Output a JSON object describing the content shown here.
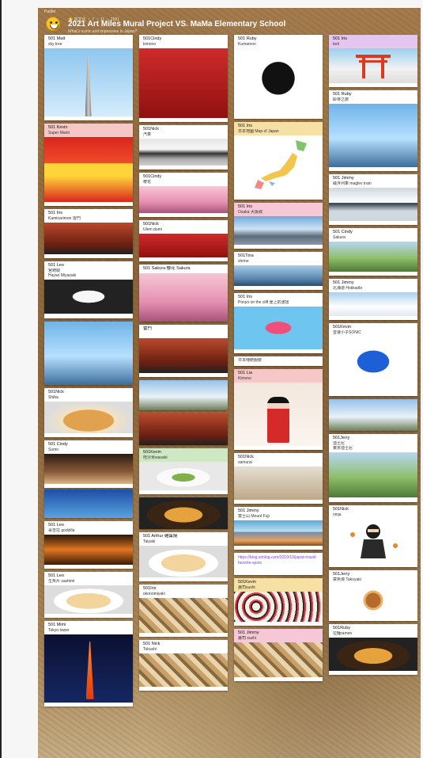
{
  "header": {
    "small_text": "Padlet",
    "meta": "⭐ 宗文化 ・ 7 ・ 11 ・ 2021",
    "title": "2021 Art Miles Mural Project VS. MaMa Elementary School",
    "subtitle": "What's iconic and impressive in Japan?"
  },
  "columns": [
    {
      "cards": [
        {
          "id": "c1",
          "author": "501 Matt",
          "caption": "sky tree",
          "image": "skytree-photo"
        },
        {
          "id": "c2",
          "author": "501 Kevin",
          "caption": "Super Mario",
          "image": "mario-photo"
        },
        {
          "id": "c3",
          "author": "501 Iris",
          "caption": "Kaminarimon 雷門",
          "image": "kaminarimon-photo"
        },
        {
          "id": "c4",
          "author": "501 Leo",
          "caption": "宮崎駿",
          "caption2": "Hayao Miyazaki",
          "image": "miyazaki-photo"
        },
        {
          "id": "c5",
          "author": "",
          "caption": "",
          "image": "anime-photo"
        },
        {
          "id": "c6",
          "author": "501Nick",
          "caption": "Shiba",
          "image": "shiba-photo"
        },
        {
          "id": "c7",
          "author": "501 Cindy",
          "caption": "Sumo",
          "image": "sumo-photo"
        },
        {
          "id": "c8",
          "author": "",
          "caption": "",
          "image": "demon-slayer-photo"
        },
        {
          "id": "c9",
          "author": "501 Leo",
          "caption": "哥吉拉 godzilla",
          "image": "godzilla-photo"
        },
        {
          "id": "c10",
          "author": "501 Leo",
          "caption": "生魚片 sashimi",
          "image": "sashimi-photo"
        },
        {
          "id": "c11",
          "author": "501 Mimi",
          "caption": "Tokyo tower",
          "image": "tokyotower-photo"
        }
      ]
    },
    {
      "cards": [
        {
          "id": "d1",
          "author": "501Cindy",
          "caption": "kimono",
          "image": "kimono-photo"
        },
        {
          "id": "d2",
          "author": "501Nick",
          "caption": "汽車",
          "image": "car-photo"
        },
        {
          "id": "d3",
          "author": "501Cindy",
          "caption": "櫻花",
          "image": "sakura-photo"
        },
        {
          "id": "d4",
          "author": "501Nick",
          "caption": "Ulem dumi",
          "image": "festival-photo"
        },
        {
          "id": "d5",
          "author": "501 Sakura 櫻花 Sakura",
          "caption": "",
          "image": "sakura-branch-photo"
        },
        {
          "id": "d6",
          "author": "雷門",
          "caption": "",
          "image": "kaminarimon-night-photo"
        },
        {
          "id": "d7",
          "author": "",
          "caption": "",
          "image": "osaka-castle-photo"
        },
        {
          "id": "d8",
          "author": "",
          "caption": "",
          "image": "shrine-photo"
        },
        {
          "id": "d9",
          "author": "501Kevin",
          "caption": "哇沙米wasabi",
          "image": "wasabi-photo"
        },
        {
          "id": "d10",
          "author": "",
          "caption": "",
          "image": "ramen-photo"
        },
        {
          "id": "d11",
          "author": "501 Arthur 雞蛋燒",
          "caption": "Taiyaki",
          "image": "taiyaki-photo"
        },
        {
          "id": "d12",
          "author": "501Iris",
          "caption": "okonomiyaki",
          "image": "okonomiyaki-photo"
        },
        {
          "id": "d13",
          "author": "501 Nick",
          "caption": "Tokushi",
          "image": "bento-photo"
        }
      ]
    },
    {
      "cards": [
        {
          "id": "e1",
          "author": "501 Ruby",
          "caption": "Kumamon",
          "image": "kumamon-photo"
        },
        {
          "id": "e2",
          "author": "501 Iris",
          "caption": "日本地圖 Map of Japan",
          "image": "japan-map"
        },
        {
          "id": "e3",
          "author": "501 Iris",
          "caption": "Osaka 大阪城",
          "image": "osaka-city-photo"
        },
        {
          "id": "e4",
          "author": "501Tina",
          "caption": "shrine",
          "image": "itsukushima-photo"
        },
        {
          "id": "e5",
          "author": "501 Iris",
          "caption": "Ponyo on the cliff 崖上的波妞",
          "image": "ponyo-photo"
        },
        {
          "id": "e6",
          "author": "",
          "caption": "日本傳統服裝",
          "image": ""
        },
        {
          "id": "e7",
          "author": "501 Lia",
          "caption": "Kimono",
          "image": "kimono-girl-photo"
        },
        {
          "id": "e8",
          "author": "501Nick",
          "caption": "samurai",
          "image": "samurai-photo"
        },
        {
          "id": "e9",
          "author": "501 Jimmy",
          "caption": "富士山 Mount Fuji",
          "image": "fuji-photo"
        },
        {
          "id": "e10",
          "author": "",
          "caption": "https://blog.sonlog.com/2019/10/japan-travel-favorite-spots",
          "image": ""
        },
        {
          "id": "e11",
          "author": "501Kevin",
          "caption": "壽司sushi",
          "image": "sushi-photo"
        },
        {
          "id": "e12",
          "author": "501 Jimmy",
          "caption": "壽司 sushi",
          "image": "oshizushi-photo"
        }
      ]
    },
    {
      "cards": [
        {
          "id": "f1",
          "author": "501 Iris",
          "caption": "torii",
          "image": "torii-photo"
        },
        {
          "id": "f2",
          "author": "501 Ruby",
          "caption": "鈴芽之旅",
          "image": "anime-scene-photo"
        },
        {
          "id": "f3",
          "author": "501 Jimmy",
          "caption": "磁浮列車 maglev train",
          "image": "maglev-photo"
        },
        {
          "id": "f4",
          "author": "501 Cindy",
          "caption": "Sakura",
          "image": "park-photo"
        },
        {
          "id": "f5",
          "author": "501 Jimmy",
          "caption": "北海道 Hokkaido",
          "image": "hokkaido-photo"
        },
        {
          "id": "f6",
          "author": "501Kevin",
          "caption": "音速小子SONIC",
          "image": "sonic-photo"
        },
        {
          "id": "f7",
          "author": "",
          "caption": "",
          "image": "castle-lake-photo"
        },
        {
          "id": "f8",
          "author": "501Jerry",
          "caption": "迪士尼",
          "caption2": "東京迪士尼",
          "image": "disney-photo"
        },
        {
          "id": "f9",
          "author": "501Nick",
          "caption": "ninja",
          "image": "ninja-photo"
        },
        {
          "id": "f10",
          "author": "501Jerry",
          "caption": "章魚燒 Takoyaki",
          "image": "takoyaki-photo"
        },
        {
          "id": "f11",
          "author": "501Ruby",
          "caption": "拉麵ramen",
          "image": "ramen-bowl-photo"
        }
      ]
    }
  ]
}
